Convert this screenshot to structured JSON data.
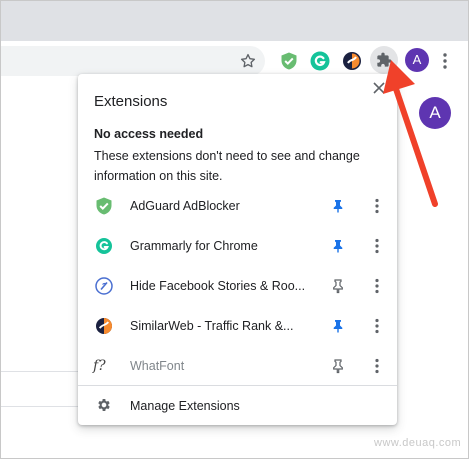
{
  "toolbar": {
    "avatar_letter": "A",
    "icons": [
      "star-icon",
      "adguard-icon",
      "grammarly-icon",
      "similarweb-icon",
      "puzzle-icon",
      "avatar",
      "more-vert-icon"
    ]
  },
  "page": {
    "avatar_letter": "A"
  },
  "popup": {
    "title": "Extensions",
    "section_title": "No access needed",
    "section_desc": "These extensions don't need to see and change information on this site.",
    "extensions": [
      {
        "name": "AdGuard AdBlocker",
        "icon": "adguard-shield-icon",
        "pinned": true,
        "enabled": true
      },
      {
        "name": "Grammarly for Chrome",
        "icon": "grammarly-icon",
        "pinned": true,
        "enabled": true
      },
      {
        "name": "Hide Facebook Stories & Roo...",
        "icon": "hide-facebook-stories-icon",
        "pinned": false,
        "enabled": true
      },
      {
        "name": "SimilarWeb - Traffic Rank &...",
        "icon": "similarweb-icon",
        "pinned": true,
        "enabled": true
      },
      {
        "name": "WhatFont",
        "icon": "whatfont-icon",
        "pinned": false,
        "enabled": false
      }
    ],
    "manage_label": "Manage Extensions",
    "whatfont_glyph": "f?"
  },
  "watermark": "www.deuaq.com",
  "colors": {
    "pin_active": "#1a73e8",
    "pin_inactive": "#5f6368",
    "avatar": "#5e35b1",
    "arrow": "#f0412a",
    "adguard": "#68bc71",
    "grammarly": "#15c39a"
  }
}
